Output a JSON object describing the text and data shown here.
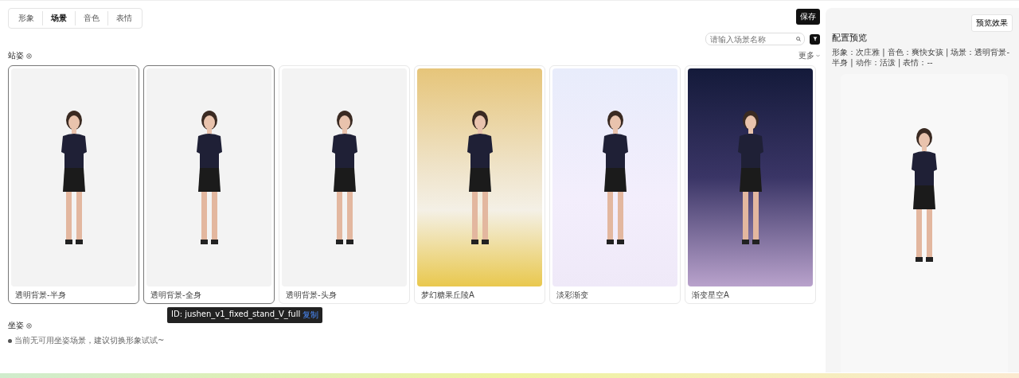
{
  "tabs": [
    {
      "label": "形象",
      "selected": false
    },
    {
      "label": "场景",
      "selected": true
    },
    {
      "label": "音色",
      "selected": false
    },
    {
      "label": "表情",
      "selected": false
    }
  ],
  "save_button": "保存",
  "search": {
    "placeholder": "请输入场景名称"
  },
  "sections": [
    {
      "title": "站姿",
      "more": "更多",
      "cards": [
        {
          "label": "透明背景-半身",
          "selected": true,
          "kind": "plain"
        },
        {
          "label": "透明背景-全身",
          "selected": true,
          "kind": "plain"
        },
        {
          "label": "透明背景-头身",
          "selected": false,
          "kind": "plain"
        },
        {
          "label": "梦幻糖果丘陵A",
          "selected": false,
          "kind": "candy"
        },
        {
          "label": "淡彩渐变",
          "selected": false,
          "kind": "pastel"
        },
        {
          "label": "渐变星空A",
          "selected": false,
          "kind": "night"
        }
      ]
    },
    {
      "title": "坐姿",
      "notice": "当前无可用坐姿场景，建议切换形象试试~"
    }
  ],
  "tooltip": {
    "text": "ID: jushen_v1_fixed_stand_V_full",
    "link": "复制"
  },
  "preview": {
    "button": "预览效果",
    "title": "配置预览",
    "summary": "形象：次庄雅 | 音色：爽快女孩 | 场景：透明背景-半身 | 动作：活泼 | 表情：--"
  }
}
